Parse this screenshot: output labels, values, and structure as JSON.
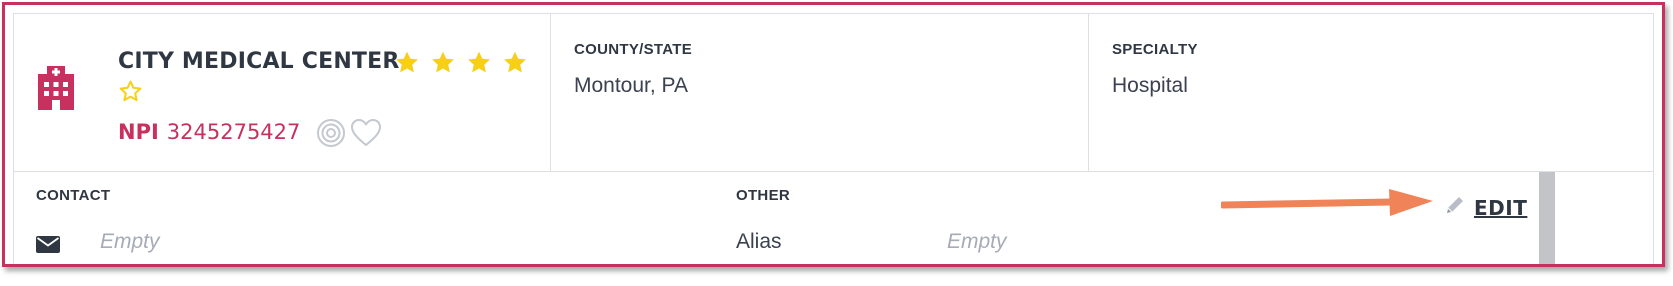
{
  "facility": {
    "name": "CITY MEDICAL CENTER",
    "rating": 4,
    "max_rating": 5,
    "npi_label": "NPI",
    "npi_number": "3245275427"
  },
  "county_state": {
    "label": "COUNTY/STATE",
    "value": "Montour, PA"
  },
  "specialty": {
    "label": "SPECIALTY",
    "value": "Hospital"
  },
  "contact": {
    "label": "CONTACT",
    "email_value": "Empty"
  },
  "other": {
    "label": "OTHER",
    "alias_label": "Alias",
    "alias_value": "Empty"
  },
  "actions": {
    "edit_label": "EDIT"
  },
  "colors": {
    "brand": "#c8305f",
    "star": "#f7cf14",
    "annotation_arrow": "#f08458",
    "text": "#2f3742"
  },
  "icons": {
    "facility": "hospital-building-icon",
    "star": "star-icon",
    "target": "target-icon",
    "favorite": "heart-icon",
    "email": "envelope-icon",
    "edit": "pencil-icon"
  }
}
